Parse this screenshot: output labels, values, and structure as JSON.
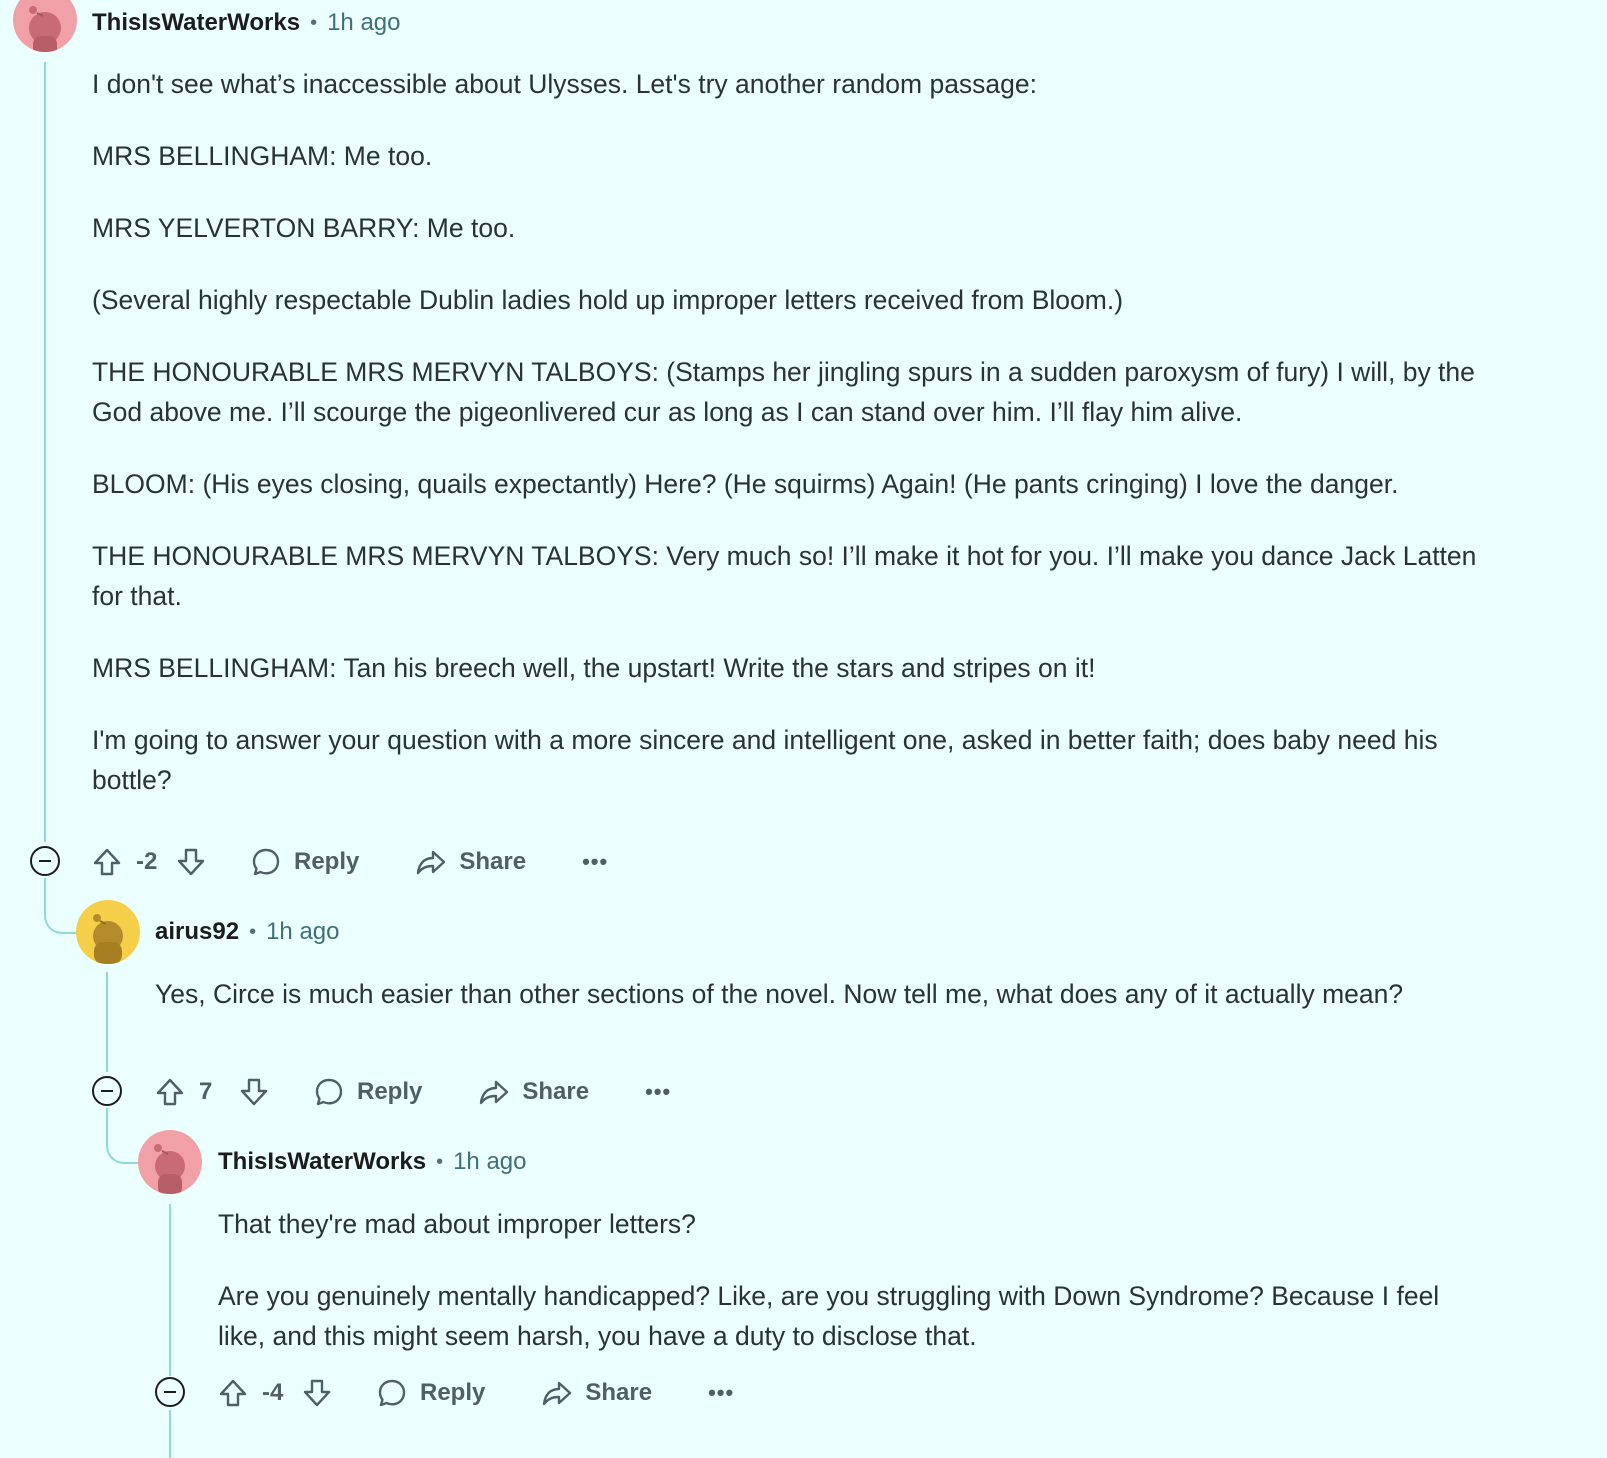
{
  "comments": [
    {
      "author": "ThisIsWaterWorks",
      "time": "1h ago",
      "avatar_color": "#f2a0a8",
      "paragraphs": [
        "I don't see what’s inaccessible about Ulysses. Let's try another random passage:",
        "MRS BELLINGHAM: Me too.",
        "MRS YELVERTON BARRY: Me too.",
        "(Several highly respectable Dublin ladies hold up improper letters received from Bloom.)",
        "THE HONOURABLE MRS MERVYN TALBOYS: (Stamps her jingling spurs in a sudden paroxysm of fury) I will, by the God above me. I’ll scourge the pigeonlivered cur as long as I can stand over him. I’ll flay him alive.",
        "BLOOM: (His eyes closing, quails expectantly) Here? (He squirms) Again! (He pants cringing) I love the danger.",
        "THE HONOURABLE MRS MERVYN TALBOYS: Very much so! I’ll make it hot for you. I’ll make you dance Jack Latten for that.",
        "MRS BELLINGHAM: Tan his breech well, the upstart! Write the stars and stripes on it!",
        "I'm going to answer your question with a more sincere and intelligent one, asked in better faith; does baby need his bottle?"
      ],
      "score": "-2",
      "reply_label": "Reply",
      "share_label": "Share",
      "more_label": "•••"
    },
    {
      "author": "airus92",
      "time": "1h ago",
      "avatar_color": "#f6cf4a",
      "paragraphs": [
        "Yes, Circe is much easier than other sections of the novel. Now tell me, what does any of it actually mean?"
      ],
      "score": "7",
      "reply_label": "Reply",
      "share_label": "Share",
      "more_label": "•••"
    },
    {
      "author": "ThisIsWaterWorks",
      "time": "1h ago",
      "avatar_color": "#f2a0a8",
      "paragraphs": [
        "That they're mad about improper letters?",
        "Are you genuinely mentally handicapped? Like, are you struggling with Down Syndrome? Because I feel like, and this might seem harsh, you have a duty to disclose that."
      ],
      "score": "-4",
      "reply_label": "Reply",
      "share_label": "Share",
      "more_label": "•••"
    }
  ],
  "separator": "•",
  "colors": {
    "background": "#eafffe",
    "thread_line": "#8fd9dc",
    "meta_time": "#3f6f78",
    "action_text": "#525e66"
  }
}
